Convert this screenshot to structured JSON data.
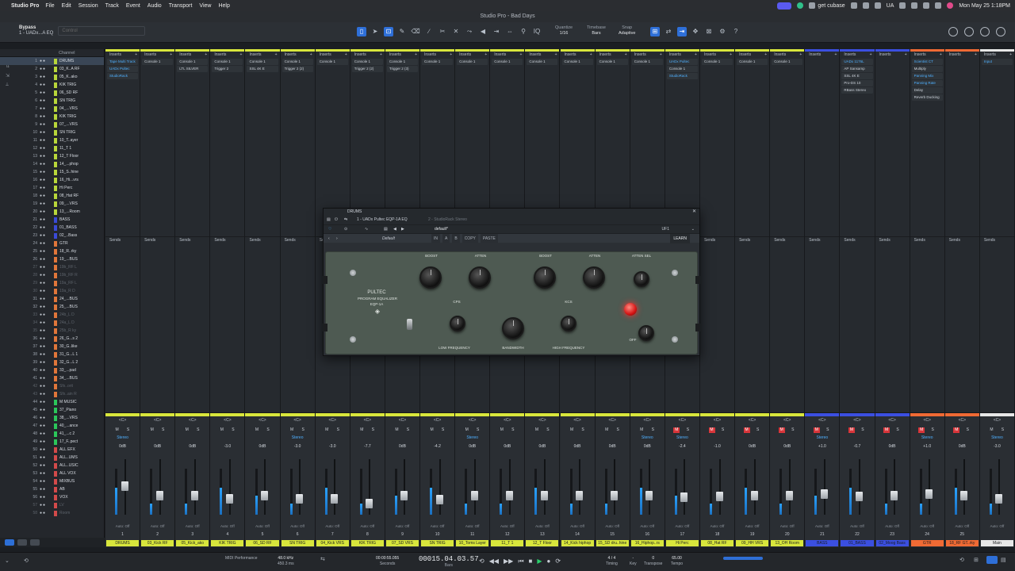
{
  "menubar": {
    "app": "Studio Pro",
    "items": [
      "File",
      "Edit",
      "Session",
      "Track",
      "Event",
      "Audio",
      "Transport",
      "View",
      "Help"
    ],
    "right": {
      "get_cubase": "get cubase",
      "lang": "UA",
      "datetime": "Mon May 25 1:18PM"
    }
  },
  "window": {
    "title": "Studio Pro - Bad Days"
  },
  "toolbar": {
    "bypass_label": "Bypass",
    "bypass_target": "1 - UADx...A EQ",
    "control_placeholder": "Control",
    "quantize_label": "Quantize",
    "quantize_value": "1/16",
    "timebase_label": "Timebase",
    "timebase_value": "Bars",
    "snap_label": "Snap",
    "snap_value": "Adaptive"
  },
  "channel_panel": {
    "header": "Channel",
    "channels": [
      {
        "n": "1",
        "name": "DRUMS",
        "color": "#b8d63a",
        "sel": true
      },
      {
        "n": "2",
        "name": "03_K..A RF",
        "color": "#b8d63a"
      },
      {
        "n": "3",
        "name": "05_K..ako",
        "color": "#b8d63a"
      },
      {
        "n": "4",
        "name": "KIK TRIG",
        "color": "#b8d63a"
      },
      {
        "n": "5",
        "name": "06_SD RF",
        "color": "#b8d63a"
      },
      {
        "n": "6",
        "name": "SN TRIG",
        "color": "#b8d63a"
      },
      {
        "n": "7",
        "name": "04_...VRS",
        "color": "#b8d63a"
      },
      {
        "n": "8",
        "name": "KIK TRIG",
        "color": "#b8d63a"
      },
      {
        "n": "9",
        "name": "07_...VRS",
        "color": "#b8d63a"
      },
      {
        "n": "10",
        "name": "SN TRIG",
        "color": "#b8d63a"
      },
      {
        "n": "11",
        "name": "10_T..ayer",
        "color": "#b8d63a"
      },
      {
        "n": "12",
        "name": "11_T 1",
        "color": "#b8d63a"
      },
      {
        "n": "13",
        "name": "12_T Floor",
        "color": "#b8d63a"
      },
      {
        "n": "14",
        "name": "14_...phop",
        "color": "#b8d63a"
      },
      {
        "n": "15",
        "name": "15_S..hine",
        "color": "#b8d63a"
      },
      {
        "n": "16",
        "name": "16_Hi...vrs",
        "color": "#b8d63a"
      },
      {
        "n": "17",
        "name": "Hi Perc",
        "color": "#b8d63a"
      },
      {
        "n": "18",
        "name": "08_Hat RF",
        "color": "#b8d63a"
      },
      {
        "n": "19",
        "name": "09_...VRS",
        "color": "#b8d63a"
      },
      {
        "n": "20",
        "name": "13_...Room",
        "color": "#b8d63a"
      },
      {
        "n": "21",
        "name": "BASS",
        "color": "#3a4ad6"
      },
      {
        "n": "22",
        "name": "01_BASS",
        "color": "#3a4ad6"
      },
      {
        "n": "23",
        "name": "02_..Bass",
        "color": "#3a4ad6"
      },
      {
        "n": "24",
        "name": "GTR",
        "color": "#e0763a"
      },
      {
        "n": "25",
        "name": "18_R..rky",
        "color": "#e0763a"
      },
      {
        "n": "26",
        "name": "19_...BUS",
        "color": "#e0763a"
      },
      {
        "n": "27",
        "name": "19b_RF L",
        "color": "#e0763a",
        "dim": true
      },
      {
        "n": "28",
        "name": "19b_RF R",
        "color": "#e0763a",
        "dim": true
      },
      {
        "n": "29",
        "name": "19a_RF L",
        "color": "#e0763a",
        "dim": true
      },
      {
        "n": "30",
        "name": "19a_R D",
        "color": "#e0763a",
        "dim": true
      },
      {
        "n": "31",
        "name": "24_...BUS",
        "color": "#e0763a"
      },
      {
        "n": "32",
        "name": "25_...BUS",
        "color": "#e0763a"
      },
      {
        "n": "33",
        "name": "24b_L D",
        "color": "#e0763a",
        "dim": true
      },
      {
        "n": "34",
        "name": "24a_L D",
        "color": "#e0763a",
        "dim": true
      },
      {
        "n": "35",
        "name": "25b_R ky",
        "color": "#e0763a",
        "dim": true
      },
      {
        "n": "36",
        "name": "26_G...s 2",
        "color": "#e0763a"
      },
      {
        "n": "37",
        "name": "30_G..like",
        "color": "#e0763a"
      },
      {
        "n": "38",
        "name": "31_G...L 1",
        "color": "#e0763a"
      },
      {
        "n": "39",
        "name": "32_G...L 2",
        "color": "#e0763a"
      },
      {
        "n": "40",
        "name": "33_...pad",
        "color": "#e0763a"
      },
      {
        "n": "41",
        "name": "34_...BUS",
        "color": "#e0763a"
      },
      {
        "n": "42",
        "name": "Sfx..orit",
        "color": "#e0763a",
        "dim": true
      },
      {
        "n": "43",
        "name": "Sfx..ain R",
        "color": "#e0763a",
        "dim": true
      },
      {
        "n": "44",
        "name": "M MUSIC",
        "color": "#2bc65a"
      },
      {
        "n": "45",
        "name": "37_Piano",
        "color": "#2bc65a"
      },
      {
        "n": "46",
        "name": "38_...VRS",
        "color": "#2bc65a"
      },
      {
        "n": "47",
        "name": "40_...ance",
        "color": "#2bc65a"
      },
      {
        "n": "48",
        "name": "41_...c 2",
        "color": "#2bc65a"
      },
      {
        "n": "49",
        "name": "17_F..pect",
        "color": "#2bc65a"
      },
      {
        "n": "50",
        "name": "ALL EFX",
        "color": "#d24a4a"
      },
      {
        "n": "51",
        "name": "ALL..UMS",
        "color": "#d24a4a"
      },
      {
        "n": "52",
        "name": "ALL..USIC",
        "color": "#d24a4a"
      },
      {
        "n": "53",
        "name": "ALL VOX",
        "color": "#d24a4a"
      },
      {
        "n": "54",
        "name": "MIXBUS",
        "color": "#d24a4a"
      },
      {
        "n": "55",
        "name": "AB",
        "color": "#d24a4a"
      },
      {
        "n": "56",
        "name": "VOX",
        "color": "#d24a4a"
      },
      {
        "n": "57",
        "name": "LV",
        "color": "#d24a4a",
        "dim": true
      },
      {
        "n": "58",
        "name": "Room",
        "color": "#d24a4a",
        "dim": true
      }
    ]
  },
  "mixer": {
    "inserts_label": "Inserts",
    "mixfx_label": "Mix FX",
    "sends_label": "Sends",
    "strips": [
      {
        "num": "1",
        "name": "DRUMS",
        "color": "#d8e63c",
        "vol": "0dB",
        "plugins": [
          "Tape Multi Track",
          "UADx Pultec",
          "StudioRack"
        ],
        "mixfx": true,
        "fader": 28
      },
      {
        "num": "2",
        "name": "03_Kick RF",
        "color": "#d8e63c",
        "vol": "0dB",
        "plugins": [
          "Console 1"
        ],
        "fader": 40
      },
      {
        "num": "3",
        "name": "05_Kick_ako",
        "color": "#d8e63c",
        "vol": "0dB",
        "plugins": [
          "Console 1",
          "LTL SILVER"
        ],
        "fader": 40
      },
      {
        "num": "4",
        "name": "KIK TRIG",
        "color": "#d8e63c",
        "vol": "-3.0",
        "plugins": [
          "Console 1",
          "Trigger 2"
        ],
        "fader": 44
      },
      {
        "num": "5",
        "name": "06_SD RF",
        "color": "#d8e63c",
        "vol": "0dB",
        "plugins": [
          "Console 1",
          "SSL 4K E"
        ],
        "fader": 40
      },
      {
        "num": "6",
        "name": "SN TRIG",
        "color": "#d8e63c",
        "vol": "-3.0",
        "plugins": [
          "Console 1",
          "Trigger 2 (2)"
        ],
        "fader": 44
      },
      {
        "num": "7",
        "name": "04_Kick VRS",
        "color": "#d8e63c",
        "vol": "-3.0",
        "plugins": [
          "Console 1"
        ],
        "fader": 44
      },
      {
        "num": "8",
        "name": "KIK TRIG",
        "color": "#d8e63c",
        "vol": "-7.7",
        "plugins": [
          "Console 1",
          "Trigger 2 (2)"
        ],
        "fader": 50
      },
      {
        "num": "9",
        "name": "07_SD VRS",
        "color": "#d8e63c",
        "vol": "0dB",
        "plugins": [
          "Console 1",
          "Trigger 2 (3)"
        ],
        "fader": 40
      },
      {
        "num": "10",
        "name": "SN TRIG",
        "color": "#d8e63c",
        "vol": "-4.2",
        "plugins": [
          "Console 1"
        ],
        "fader": 45
      },
      {
        "num": "11",
        "name": "10_Toms Layer",
        "color": "#d8e63c",
        "vol": "0dB",
        "plugins": [
          "Console 1"
        ],
        "fader": 40
      },
      {
        "num": "12",
        "name": "11_T 1",
        "color": "#d8e63c",
        "vol": "0dB",
        "plugins": [
          "Console 1"
        ],
        "fader": 40
      },
      {
        "num": "13",
        "name": "12_T Floor",
        "color": "#d8e63c",
        "vol": "0dB",
        "plugins": [
          "Console 1"
        ],
        "fader": 40
      },
      {
        "num": "14",
        "name": "14_Kick hiphop",
        "color": "#d8e63c",
        "vol": "0dB",
        "plugins": [
          "Console 1"
        ],
        "fader": 40
      },
      {
        "num": "15",
        "name": "15_SD dru..hine",
        "color": "#d8e63c",
        "vol": "0dB",
        "plugins": [
          "Console 1"
        ],
        "fader": 40
      },
      {
        "num": "16",
        "name": "16_Hiphop..rs",
        "color": "#d8e63c",
        "vol": "0dB",
        "plugins": [
          "Console 1"
        ],
        "fader": 40
      },
      {
        "num": "17",
        "name": "Hi Perc",
        "color": "#d8e63c",
        "vol": "-2.4",
        "plugins": [
          "UADx Pultec",
          "Console 1",
          "StudioRack"
        ],
        "mixfx": true,
        "fader": 42,
        "mute": true
      },
      {
        "num": "18",
        "name": "08_Hat RF",
        "color": "#d8e63c",
        "vol": "-1.0",
        "plugins": [
          "Console 1"
        ],
        "fader": 41,
        "mute": true
      },
      {
        "num": "19",
        "name": "09_HH VRS",
        "color": "#d8e63c",
        "vol": "0dB",
        "plugins": [
          "Console 1"
        ],
        "fader": 40,
        "mute": true
      },
      {
        "num": "20",
        "name": "13_OH Room",
        "color": "#d8e63c",
        "vol": "0dB",
        "plugins": [
          "Console 1"
        ],
        "fader": 40,
        "mute": true
      },
      {
        "num": "21",
        "name": "BASS",
        "color": "#3b4fe0",
        "vol": "+1.0",
        "plugins": [],
        "mixfx": true,
        "fader": 38,
        "mute": true
      },
      {
        "num": "22",
        "name": "01_BASS",
        "color": "#3b4fe0",
        "vol": "-0.7",
        "plugins": [
          "UADx 1176L",
          "AP Sansamp",
          "SSL 4K E",
          "Pro-DS 10",
          "RBass Stereo"
        ],
        "fader": 41,
        "mute": true
      },
      {
        "num": "23",
        "name": "02_Moog Bass",
        "color": "#3b4fe0",
        "vol": "0dB",
        "plugins": [],
        "fader": 40,
        "mute": true
      },
      {
        "num": "24",
        "name": "GTR",
        "color": "#f06a34",
        "vol": "+1.0",
        "plugins": [
          "Scientist CT",
          "Multiply",
          "Panning Mix",
          "Panning Rate",
          "Delay",
          "Reverb Ducking"
        ],
        "mixfx": true,
        "fader": 38,
        "mute": true
      },
      {
        "num": "25",
        "name": "18_RF GT..rky",
        "color": "#f06a34",
        "vol": "0dB",
        "plugins": [],
        "fader": 40,
        "mute": true
      },
      {
        "num": "",
        "name": "Main",
        "color": "#e7e7e7",
        "vol": "-3.0",
        "plugins": [
          "Input"
        ],
        "mixfx": true,
        "fader": 44
      }
    ]
  },
  "plugin": {
    "channel": "DRUMS",
    "insert_name": "1 - UADx Pultec EQP-1A EQ",
    "insert_2": "2 - StudioRack Stereo",
    "preset": "default*",
    "ufi": "UF1",
    "preset_name": "Default",
    "copy_label": "COPY",
    "paste_label": "PASTE",
    "learn_label": "LEARN",
    "brand": "PULTEC",
    "model_line": "PROGRAM EQUALIZER",
    "model": "EQP-1A",
    "labels": {
      "boost1": "BOOST",
      "atten1": "ATTEN",
      "boost2": "BOOST",
      "atten2": "ATTEN",
      "atten_sel": "ATTEN SEL",
      "cps": "CPS",
      "kcs": "KCS",
      "low_freq": "LOW FREQUENCY",
      "bandwidth": "BANDWIDTH",
      "high_freq": "HIGH FREQUENCY",
      "off": "OFF"
    }
  },
  "transport": {
    "midi": "MIDI",
    "performance": "Performance",
    "rate": "48.0 kHz",
    "latency": "450.3 ms",
    "seconds": "00:00:55.055",
    "seconds_label": "Seconds",
    "bars": "00015.04.03.57",
    "bars_label": "Bars",
    "timing": "4 / 4",
    "timing_label": "Timing",
    "key": "-",
    "key_label": "Key",
    "transpose": "0",
    "transpose_label": "Transpose",
    "tempo": "65.00",
    "tempo_label": "Tempo"
  }
}
